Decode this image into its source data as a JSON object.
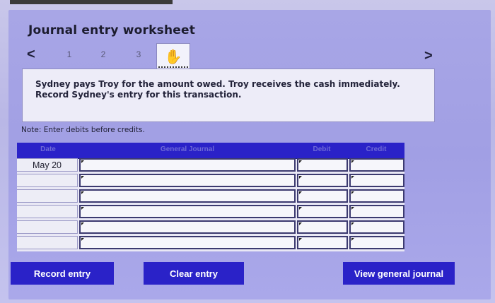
{
  "header": {
    "title": "Journal entry worksheet"
  },
  "nav": {
    "prev": "<",
    "next": ">",
    "steps": [
      "1",
      "2",
      "3"
    ],
    "active_icon": "✋"
  },
  "instructions": {
    "line1": "Sydney pays Troy for the amount owed. Troy receives the cash immediately.",
    "line2": "Record Sydney's entry for this transaction."
  },
  "note": "Note: Enter debits before credits.",
  "table": {
    "headers": {
      "date": "Date",
      "general_journal": "General Journal",
      "debit": "Debit",
      "credit": "Credit"
    },
    "rows": [
      {
        "date": "May 20",
        "account": "",
        "debit": "",
        "credit": ""
      },
      {
        "date": "",
        "account": "",
        "debit": "",
        "credit": ""
      },
      {
        "date": "",
        "account": "",
        "debit": "",
        "credit": ""
      },
      {
        "date": "",
        "account": "",
        "debit": "",
        "credit": ""
      },
      {
        "date": "",
        "account": "",
        "debit": "",
        "credit": ""
      },
      {
        "date": "",
        "account": "",
        "debit": "",
        "credit": ""
      }
    ]
  },
  "buttons": {
    "record": "Record entry",
    "clear": "Clear entry",
    "view": "View general journal"
  },
  "colors": {
    "accent": "#2a22c8",
    "panel": "#a8a6e6"
  }
}
